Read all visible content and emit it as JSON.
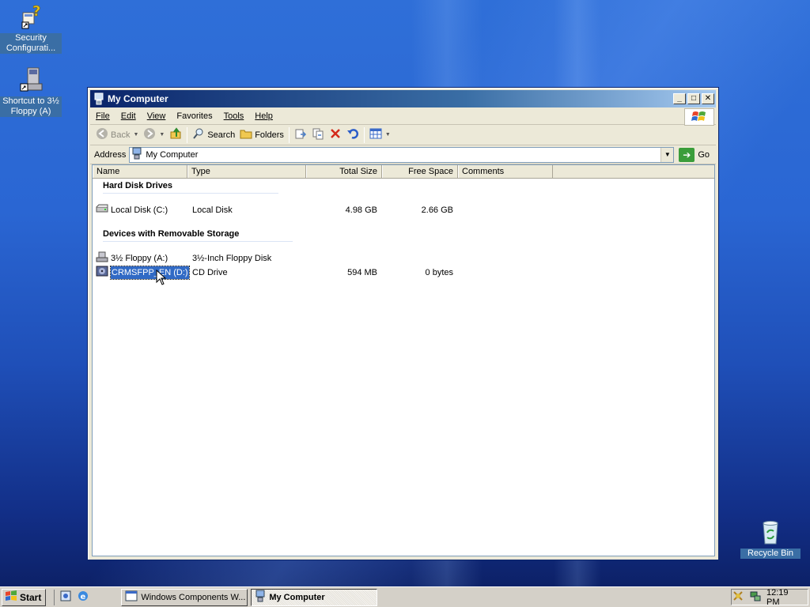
{
  "desktop": {
    "icons": [
      {
        "label_line1": "Security",
        "label_line2": "Configurati..."
      },
      {
        "label_line1": "Shortcut to 3½",
        "label_line2": "Floppy (A)"
      },
      {
        "label_line1": "Recycle Bin",
        "label_line2": ""
      }
    ]
  },
  "window": {
    "title": "My Computer",
    "menu": [
      "File",
      "Edit",
      "View",
      "Favorites",
      "Tools",
      "Help"
    ],
    "toolbar": {
      "back": "Back",
      "search": "Search",
      "folders": "Folders"
    },
    "address": {
      "label": "Address",
      "value": "My Computer",
      "go": "Go"
    },
    "columns": [
      "Name",
      "Type",
      "Total Size",
      "Free Space",
      "Comments"
    ],
    "groups": [
      {
        "title": "Hard Disk Drives",
        "items": [
          {
            "name": "Local Disk (C:)",
            "type": "Local Disk",
            "total": "4.98 GB",
            "free": "2.66 GB"
          }
        ]
      },
      {
        "title": "Devices with Removable Storage",
        "items": [
          {
            "name": "3½ Floppy (A:)",
            "type": "3½-Inch Floppy Disk",
            "total": "",
            "free": ""
          },
          {
            "name": "CRMSFPP_EN (D:)",
            "type": "CD Drive",
            "total": "594 MB",
            "free": "0 bytes"
          }
        ]
      }
    ]
  },
  "taskbar": {
    "start": "Start",
    "tasks": [
      "Windows Components W...",
      "My Computer"
    ],
    "clock": "12:19 PM"
  },
  "colors": {
    "selection": "#316ac5",
    "title_start": "#0a246a",
    "title_end": "#a6caf0"
  }
}
